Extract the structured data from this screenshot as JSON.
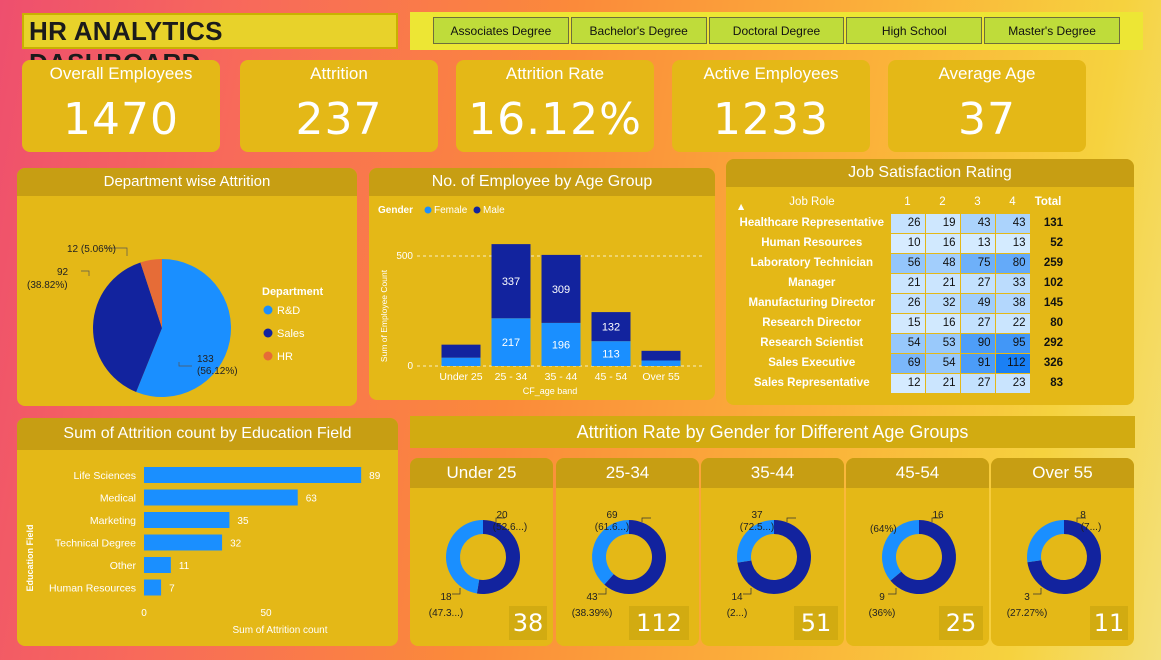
{
  "header": {
    "title": "HR ANALYTICS DASHBOARD",
    "education_filters": [
      "Associates Degree",
      "Bachelor's Degree",
      "Doctoral Degree",
      "High School",
      "Master's Degree"
    ]
  },
  "kpis": [
    {
      "label": "Overall Employees",
      "value": "1470"
    },
    {
      "label": "Attrition",
      "value": "237"
    },
    {
      "label": "Attrition Rate",
      "value": "16.12%"
    },
    {
      "label": "Active Employees",
      "value": "1233"
    },
    {
      "label": "Average Age",
      "value": "37"
    }
  ],
  "colors": {
    "rnd": "#1a8fff",
    "sales": "#12239e",
    "hr": "#e66c37",
    "female": "#1a8fff",
    "male": "#12239e",
    "card": "#e4b817"
  },
  "chart_data": [
    {
      "type": "pie",
      "title": "Department wise Attrition",
      "legend_title": "Department",
      "legend_position": "right",
      "slices": [
        {
          "name": "R&D",
          "value": 133,
          "label": "133",
          "pct": "(56.12%)"
        },
        {
          "name": "Sales",
          "value": 92,
          "label": "92",
          "pct": "(38.82%)"
        },
        {
          "name": "HR",
          "value": 12,
          "label": "12 (5.06%)",
          "pct": ""
        }
      ]
    },
    {
      "type": "bar",
      "stacked": true,
      "title": "No. of Employee by Age Group",
      "legend_title": "Gender",
      "legend_position": "top-left",
      "xlabel": "CF_age band",
      "ylabel": "Sum of Employee Count",
      "categories": [
        "Under 25",
        "25 - 34",
        "35 - 44",
        "45 - 54",
        "Over 55"
      ],
      "series": [
        {
          "name": "Female",
          "values": [
            38,
            217,
            196,
            113,
            25
          ],
          "labels": [
            "",
            "217",
            "196",
            "113",
            ""
          ]
        },
        {
          "name": "Male",
          "values": [
            59,
            337,
            309,
            132,
            44
          ],
          "labels": [
            "",
            "337",
            "309",
            "132",
            ""
          ]
        }
      ],
      "ylim": [
        0,
        600
      ],
      "yticks": [
        0,
        500
      ],
      "ytick_labels": [
        "0",
        "500"
      ]
    },
    {
      "type": "table",
      "title": "Job Satisfaction Rating",
      "columns": [
        "Job Role",
        "1",
        "2",
        "3",
        "4",
        "Total"
      ],
      "rows": [
        {
          "role": "Healthcare Representative",
          "values": [
            26,
            19,
            43,
            43
          ],
          "total": 131
        },
        {
          "role": "Human Resources",
          "values": [
            10,
            16,
            13,
            13
          ],
          "total": 52
        },
        {
          "role": "Laboratory Technician",
          "values": [
            56,
            48,
            75,
            80
          ],
          "total": 259
        },
        {
          "role": "Manager",
          "values": [
            21,
            21,
            27,
            33
          ],
          "total": 102
        },
        {
          "role": "Manufacturing Director",
          "values": [
            26,
            32,
            49,
            38
          ],
          "total": 145
        },
        {
          "role": "Research Director",
          "values": [
            15,
            16,
            27,
            22
          ],
          "total": 80
        },
        {
          "role": "Research Scientist",
          "values": [
            54,
            53,
            90,
            95
          ],
          "total": 292
        },
        {
          "role": "Sales Executive",
          "values": [
            69,
            54,
            91,
            112
          ],
          "total": 326
        },
        {
          "role": "Sales Representative",
          "values": [
            12,
            21,
            27,
            23
          ],
          "total": 83
        }
      ]
    },
    {
      "type": "bar",
      "orientation": "horizontal",
      "title": "Sum of Attrition count by Education Field",
      "xlabel": "Sum of Attrition count",
      "ylabel": "Education Field",
      "categories": [
        "Life Sciences",
        "Medical",
        "Marketing",
        "Technical Degree",
        "Other",
        "Human Resources"
      ],
      "values": [
        89,
        63,
        35,
        32,
        11,
        7
      ],
      "xlim": [
        0,
        95
      ],
      "xticks": [
        0,
        50
      ],
      "xtick_labels": [
        "0",
        "50"
      ]
    },
    {
      "type": "pie",
      "subtype": "donut",
      "section_title": "Attrition Rate by Gender for Different Age Groups",
      "groups": [
        {
          "title": "Under 25",
          "total": "38",
          "male": 20,
          "female": 18,
          "male_label": "20",
          "male_pct": "(52.6...)",
          "female_label": "18",
          "female_pct": "(47.3...)"
        },
        {
          "title": "25-34",
          "total": "112",
          "male": 69,
          "female": 43,
          "male_label": "69",
          "male_pct": "(61.6...)",
          "female_label": "43",
          "female_pct": "(38.39%)"
        },
        {
          "title": "35-44",
          "total": "51",
          "male": 37,
          "female": 14,
          "male_label": "37",
          "male_pct": "(72.5...)",
          "female_label": "14",
          "female_pct": "(2...)"
        },
        {
          "title": "45-54",
          "total": "25",
          "male": 16,
          "female": 9,
          "male_label": "16",
          "male_pct": "(64%)",
          "female_label": "9",
          "female_pct": "(36%)"
        },
        {
          "title": "Over 55",
          "total": "11",
          "male": 8,
          "female": 3,
          "male_label": "8",
          "male_pct": "(7...)",
          "female_label": "3",
          "female_pct": "(27.27%)"
        }
      ]
    }
  ]
}
